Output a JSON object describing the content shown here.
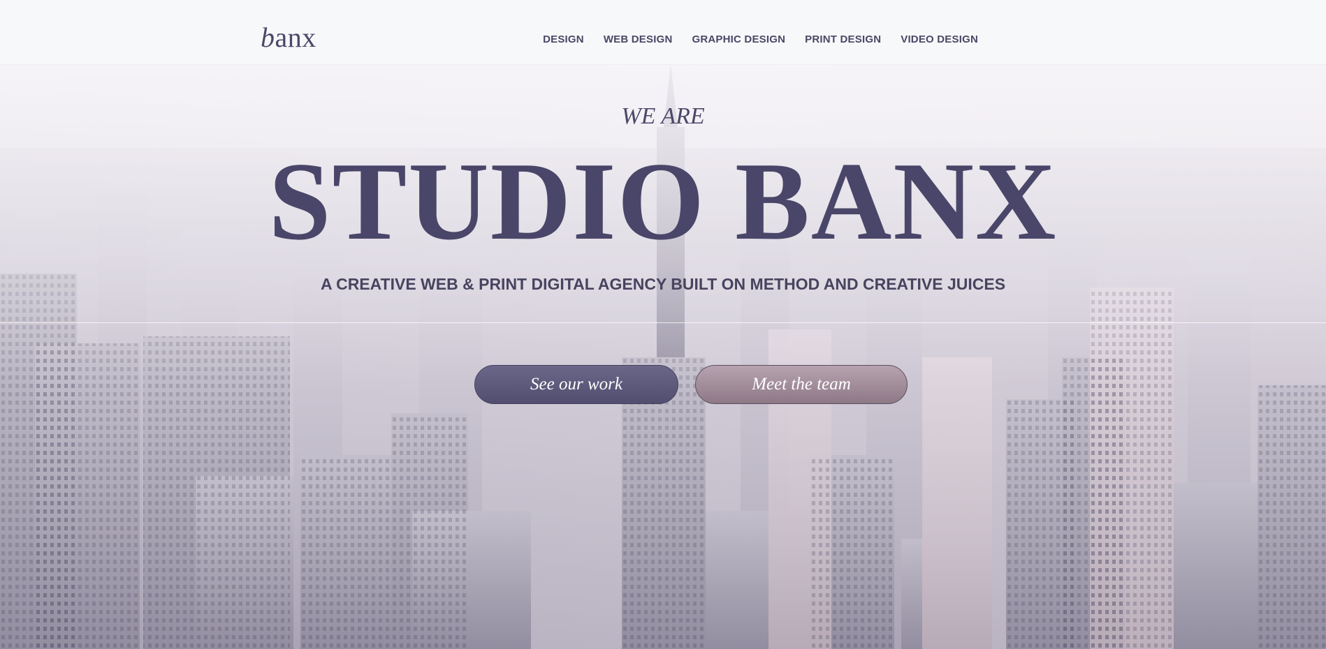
{
  "header": {
    "logo": {
      "initial": "b",
      "rest": "anx"
    },
    "nav": [
      "DESIGN",
      "WEB DESIGN",
      "GRAPHIC DESIGN",
      "PRINT DESIGN",
      "VIDEO DESIGN"
    ]
  },
  "hero": {
    "kicker": "WE ARE",
    "headline": "STUDIO BANX",
    "tagline": "A CREATIVE WEB & PRINT DIGITAL AGENCY BUILT ON METHOD AND CREATIVE JUICES",
    "buttons": {
      "work": "See our work",
      "team": "Meet the team"
    }
  },
  "colors": {
    "brand": "#4a4669",
    "header_bg": "#f7f8fa",
    "button_primary": "#5c5879",
    "button_secondary": "#a38f9c"
  }
}
